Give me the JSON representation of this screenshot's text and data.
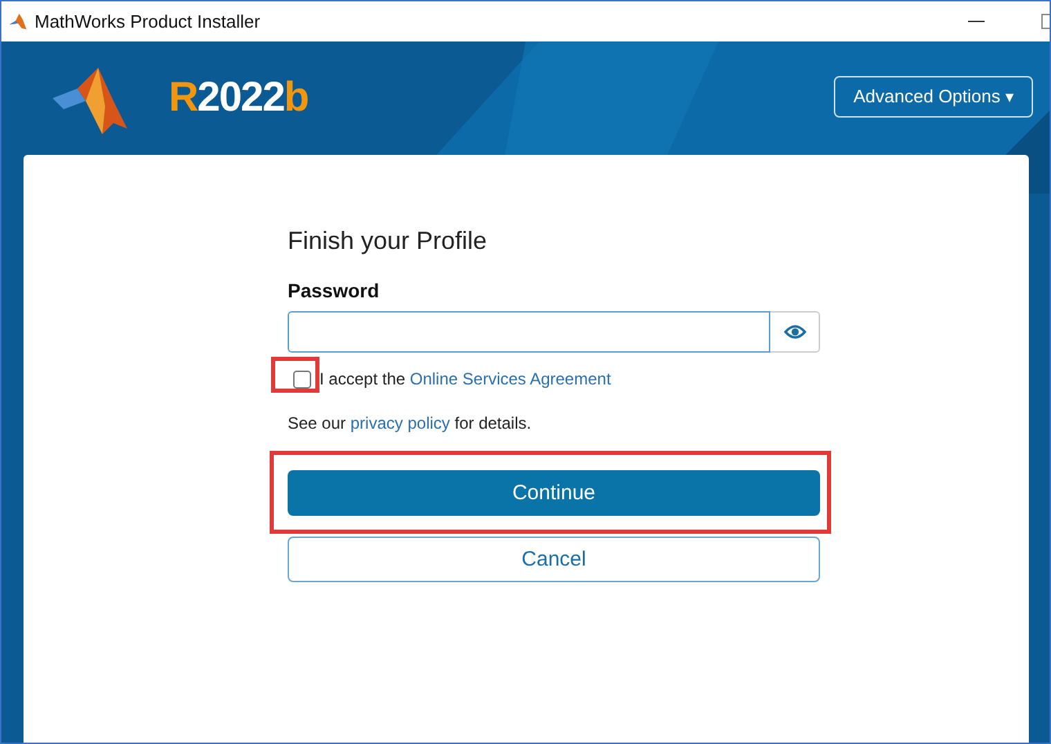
{
  "window": {
    "title": "MathWorks Product Installer"
  },
  "release": [
    {
      "text": "R",
      "color": "#f0960f"
    },
    {
      "text": "2022",
      "color": "#ffffff"
    },
    {
      "text": "b",
      "color": "#f0960f"
    }
  ],
  "advanced_options": {
    "label": "Advanced Options",
    "caret": "▾"
  },
  "form": {
    "heading": "Finish your Profile",
    "password_label": "Password",
    "agreement": {
      "checked": false,
      "highlighted": true,
      "text": "I accept the ",
      "link": "Online Services Agreement"
    },
    "privacy": {
      "before": "See our ",
      "link": "privacy policy",
      "after": " for details."
    },
    "continue_button": {
      "label": "Continue",
      "highlighted": true
    },
    "cancel_button": {
      "label": "Cancel"
    }
  }
}
